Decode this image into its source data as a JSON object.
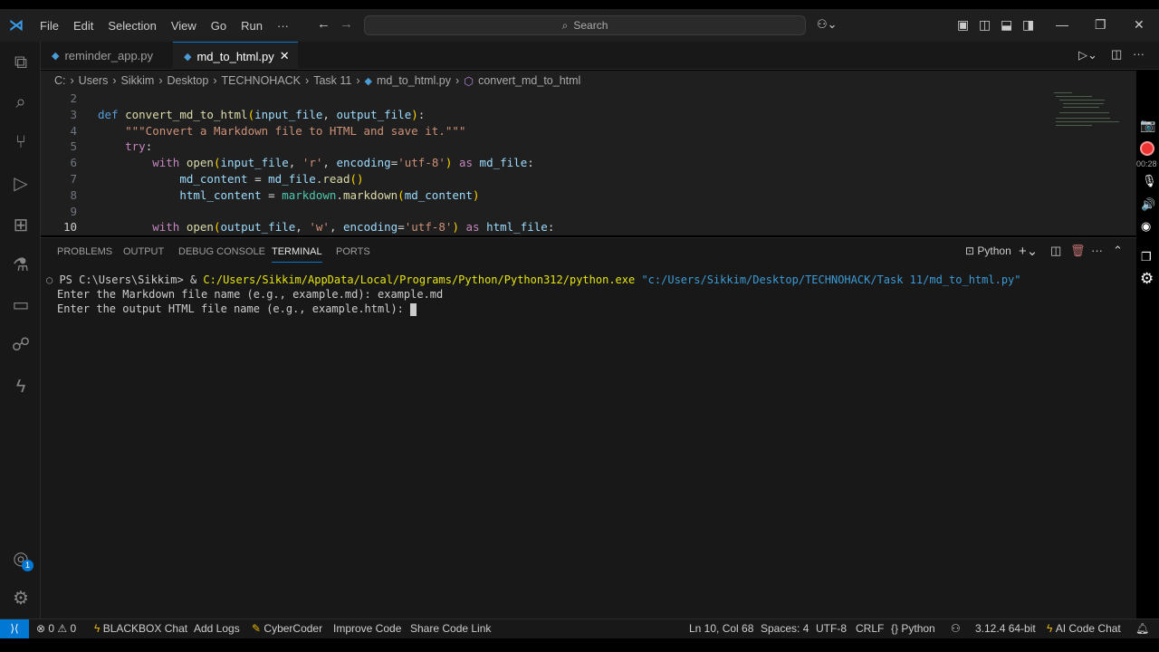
{
  "menu": [
    "File",
    "Edit",
    "Selection",
    "View",
    "Go",
    "Run",
    "···"
  ],
  "search_label": "Search",
  "tabs": [
    {
      "label": "reminder_app.py",
      "active": false
    },
    {
      "label": "md_to_html.py",
      "active": true
    }
  ],
  "breadcrumb": [
    "C:",
    "Users",
    "Sikkim",
    "Desktop",
    "TECHNOHACK",
    "Task 11",
    "md_to_html.py",
    "convert_md_to_html"
  ],
  "code": [
    {
      "n": "2",
      "tokens": []
    },
    {
      "n": "3",
      "tokens": [
        [
          "def ",
          "k"
        ],
        [
          "convert_md_to_html",
          "f"
        ],
        [
          "(",
          "y"
        ],
        [
          "input_file",
          "v"
        ],
        [
          ", ",
          "p"
        ],
        [
          "output_file",
          "v"
        ],
        [
          ")",
          "y"
        ],
        [
          ":",
          "p"
        ]
      ]
    },
    {
      "n": "4",
      "tokens": [
        [
          "    ",
          "p"
        ],
        [
          "\"\"\"Convert a Markdown file to HTML and save it.\"\"\"",
          "s"
        ]
      ]
    },
    {
      "n": "5",
      "tokens": [
        [
          "    ",
          "p"
        ],
        [
          "try",
          "c"
        ],
        [
          ":",
          "p"
        ]
      ]
    },
    {
      "n": "6",
      "tokens": [
        [
          "        ",
          "p"
        ],
        [
          "with ",
          "c"
        ],
        [
          "open",
          "f"
        ],
        [
          "(",
          "y"
        ],
        [
          "input_file",
          "v"
        ],
        [
          ", ",
          "p"
        ],
        [
          "'r'",
          "s"
        ],
        [
          ", ",
          "p"
        ],
        [
          "encoding",
          "v"
        ],
        [
          "=",
          "p"
        ],
        [
          "'utf-8'",
          "s"
        ],
        [
          ")",
          "y"
        ],
        [
          " as ",
          "c"
        ],
        [
          "md_file",
          "v"
        ],
        [
          ":",
          "p"
        ]
      ]
    },
    {
      "n": "7",
      "tokens": [
        [
          "            ",
          "p"
        ],
        [
          "md_content",
          "v"
        ],
        [
          " = ",
          "p"
        ],
        [
          "md_file",
          "v"
        ],
        [
          ".",
          "p"
        ],
        [
          "read",
          "f"
        ],
        [
          "()",
          "y"
        ]
      ]
    },
    {
      "n": "8",
      "tokens": [
        [
          "            ",
          "p"
        ],
        [
          "html_content",
          "v"
        ],
        [
          " = ",
          "p"
        ],
        [
          "markdown",
          "t"
        ],
        [
          ".",
          "p"
        ],
        [
          "markdown",
          "f"
        ],
        [
          "(",
          "y"
        ],
        [
          "md_content",
          "v"
        ],
        [
          ")",
          "y"
        ]
      ]
    },
    {
      "n": "9",
      "tokens": []
    },
    {
      "n": "10",
      "tokens": [
        [
          "        ",
          "p"
        ],
        [
          "with ",
          "c"
        ],
        [
          "open",
          "f"
        ],
        [
          "(",
          "y"
        ],
        [
          "output_file",
          "v"
        ],
        [
          ", ",
          "p"
        ],
        [
          "'w'",
          "s"
        ],
        [
          ", ",
          "p"
        ],
        [
          "encoding",
          "v"
        ],
        [
          "=",
          "p"
        ],
        [
          "'utf-8'",
          "s"
        ],
        [
          ")",
          "y"
        ],
        [
          " as ",
          "c"
        ],
        [
          "html_file",
          "v"
        ],
        [
          ":",
          "p"
        ]
      ]
    }
  ],
  "panel_tabs": [
    "PROBLEMS",
    "OUTPUT",
    "DEBUG CONSOLE",
    "TERMINAL",
    "PORTS"
  ],
  "terminal_shell": "Python",
  "terminal": {
    "prompt": "PS C:\\Users\\Sikkim> & ",
    "exe": "C:/Users/Sikkim/AppData/Local/Programs/Python/Python312/python.exe",
    "script": " \"c:/Users/Sikkim/Desktop/TECHNOHACK/Task 11/md_to_html.py\"",
    "line2": "Enter the Markdown file name (e.g., example.md): example.md",
    "line3": "Enter the output HTML file name (e.g., example.html): "
  },
  "status": {
    "errors": "0",
    "warnings": "0",
    "blackbox": "BLACKBOX Chat",
    "addlogs": "Add Logs",
    "cybercoder": "CyberCoder",
    "improve": "Improve Code",
    "share": "Share Code Link",
    "position": "Ln 10, Col 68",
    "spaces": "Spaces: 4",
    "encoding": "UTF-8",
    "eol": "CRLF",
    "language": "Python",
    "interpreter": "3.12.4 64-bit",
    "aichat": "AI Code Chat"
  },
  "recorder_time": "00:28",
  "accounts_badge": "1"
}
